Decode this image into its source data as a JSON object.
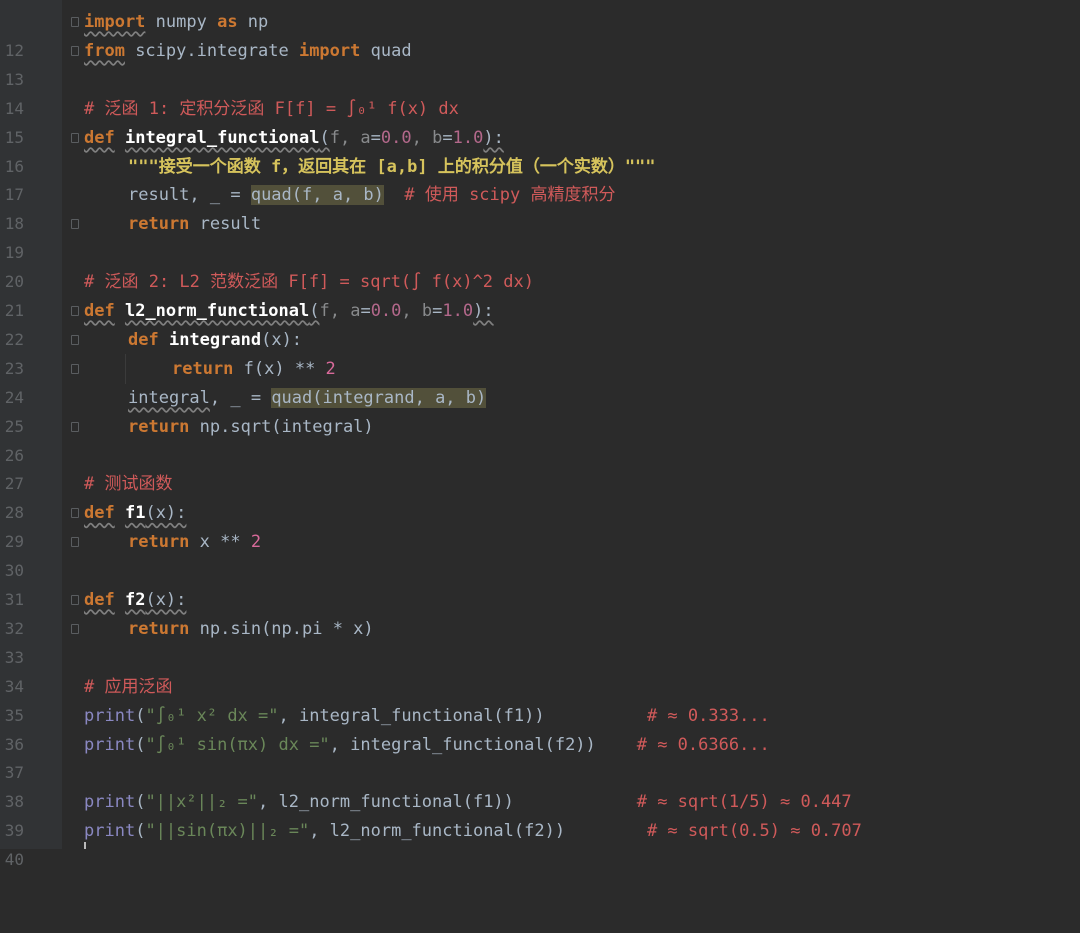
{
  "editor": {
    "line_numbers": [
      "12",
      "13",
      "14",
      "15",
      "16",
      "17",
      "18",
      "19",
      "20",
      "21",
      "22",
      "23",
      "24",
      "25",
      "26",
      "27",
      "28",
      "29",
      "30",
      "31",
      "32",
      "33",
      "34",
      "35",
      "36",
      "37",
      "38",
      "39",
      "40"
    ],
    "l12": {
      "kw1": "import",
      "mod": " numpy ",
      "kw2": "as",
      "alias": " np"
    },
    "l13": {
      "kw1": "from",
      "mod": " scipy.integrate ",
      "kw2": "import",
      "name": " quad"
    },
    "l15": {
      "comment": "# 泛函 1: 定积分泛函 F[f] = ∫₀¹ f(x) dx"
    },
    "l16": {
      "kw": "def",
      "name": "integral_functional",
      "open": "(",
      "p1": "f",
      "sep1": ", ",
      "p2": "a",
      "eq1": "=",
      "v1": "0.0",
      "sep2": ", ",
      "p3": "b",
      "eq2": "=",
      "v2": "1.0",
      "close": "):"
    },
    "l17": {
      "doc": "\"\"\"接受一个函数 f，返回其在 [a,b] 上的积分值（一个实数）\"\"\""
    },
    "l18": {
      "pre": "result, _ = ",
      "call": "quad(f, a, b)",
      "comment": "  # 使用 scipy 高精度积分"
    },
    "l19": {
      "kw": "return",
      "rest": " result"
    },
    "l21": {
      "comment": "# 泛函 2: L2 范数泛函 F[f] = sqrt(∫ f(x)^2 dx)"
    },
    "l22": {
      "kw": "def",
      "name": "l2_norm_functional",
      "open": "(",
      "p1": "f",
      "sep1": ", ",
      "p2": "a",
      "eq1": "=",
      "v1": "0.0",
      "sep2": ", ",
      "p3": "b",
      "eq2": "=",
      "v2": "1.0",
      "close": "):"
    },
    "l23": {
      "kw": "def",
      "name": "integrand",
      "args": "(x):"
    },
    "l24": {
      "kw": "return",
      "pre": " f(x) ** ",
      "num": "2"
    },
    "l25": {
      "var": "integral",
      "pre": ", _ = ",
      "call": "quad(integrand, a, b)"
    },
    "l26": {
      "kw": "return",
      "rest": " np.sqrt(integral)"
    },
    "l28": {
      "comment": "# 测试函数"
    },
    "l29": {
      "kw": "def",
      "name": "f1",
      "args": "(x):"
    },
    "l30": {
      "kw": "return",
      "pre": " x ** ",
      "num": "2"
    },
    "l32": {
      "kw": "def",
      "name": "f2",
      "args": "(x):"
    },
    "l33": {
      "kw": "return",
      "rest": " np.sin(np.pi * x)"
    },
    "l35": {
      "comment": "# 应用泛函"
    },
    "l36": {
      "fn": "print",
      "open": "(",
      "str": "\"∫₀¹ x² dx =\"",
      "rest": ", integral_functional(f1))",
      "comment": "          # ≈ 0.333..."
    },
    "l37": {
      "fn": "print",
      "open": "(",
      "str": "\"∫₀¹ sin(πx) dx =\"",
      "rest": ", integral_functional(f2))",
      "comment": "    # ≈ 0.6366..."
    },
    "l39": {
      "fn": "print",
      "open": "(",
      "str": "\"||x²||₂ =\"",
      "rest": ", l2_norm_functional(f1))",
      "comment": "            # ≈ sqrt(1/5) ≈ 0.447"
    },
    "l40": {
      "fn": "print",
      "open": "(",
      "str": "\"||sin(πx)||₂ =\"",
      "rest": ", l2_norm_functional(f2))",
      "comment": "        # ≈ sqrt(0.5) ≈ 0.707"
    }
  },
  "colors": {
    "background": "#2b2b2b",
    "keyword": "#cc7832",
    "comment": "#d05a5a",
    "number": "#d86a9a",
    "docstring": "#d6c35c",
    "string": "#6a8759",
    "builtin": "#8a88c2",
    "highlight": "#52503a"
  }
}
